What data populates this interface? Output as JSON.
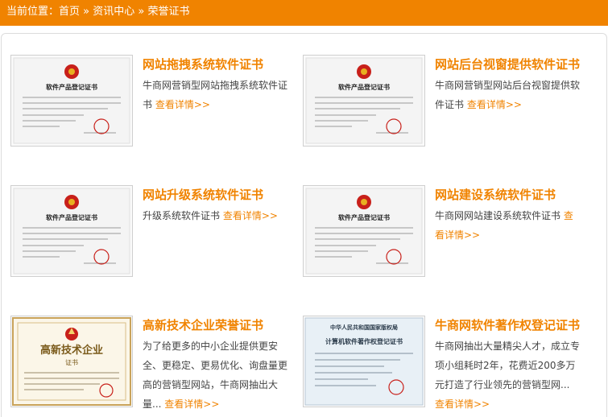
{
  "breadcrumb": {
    "prefix": "当前位置：",
    "home": "首页",
    "sep1": " » ",
    "info_center": "资讯中心",
    "sep2": " » ",
    "current": "荣誉证书"
  },
  "items": [
    {
      "title": "网站拖拽系统软件证书",
      "desc": "牛商网营销型网站拖拽系统软件证书",
      "more": "查看详情>>",
      "cert_title": "软件产品登记证书"
    },
    {
      "title": "网站后台视窗提供软件证书",
      "desc": "牛商网营销型网站后台视窗提供软件证书",
      "more": "查看详情>>",
      "cert_title": "软件产品登记证书"
    },
    {
      "title": "网站升级系统软件证书",
      "desc": "升级系统软件证书",
      "more": "查看详情>>",
      "cert_title": "软件产品登记证书"
    },
    {
      "title": "网站建设系统软件证书",
      "desc": "牛商网网站建设系统软件证书",
      "more": "查看详情>>",
      "cert_title": "软件产品登记证书"
    },
    {
      "title": "高新技术企业荣誉证书",
      "desc": "为了给更多的中小企业提供更安全、更稳定、更易优化、询盘量更高的营销型网站，牛商网抽出大量...",
      "more": "查看详情>>",
      "cert_title": "高新技术企业",
      "cert_sub": "证书"
    },
    {
      "title": "牛商网软件著作权登记证书",
      "desc": "牛商网抽出大量精尖人才，成立专项小组耗时2年，花费近200多万元打造了行业领先的营销型网...",
      "more": "查看详情>>",
      "cert_title": "计算机软件著作权登记证书",
      "cert_top": "中华人民共和国国家版权局"
    }
  ],
  "colors": {
    "accent": "#f08300",
    "seal": "#c8201a"
  }
}
